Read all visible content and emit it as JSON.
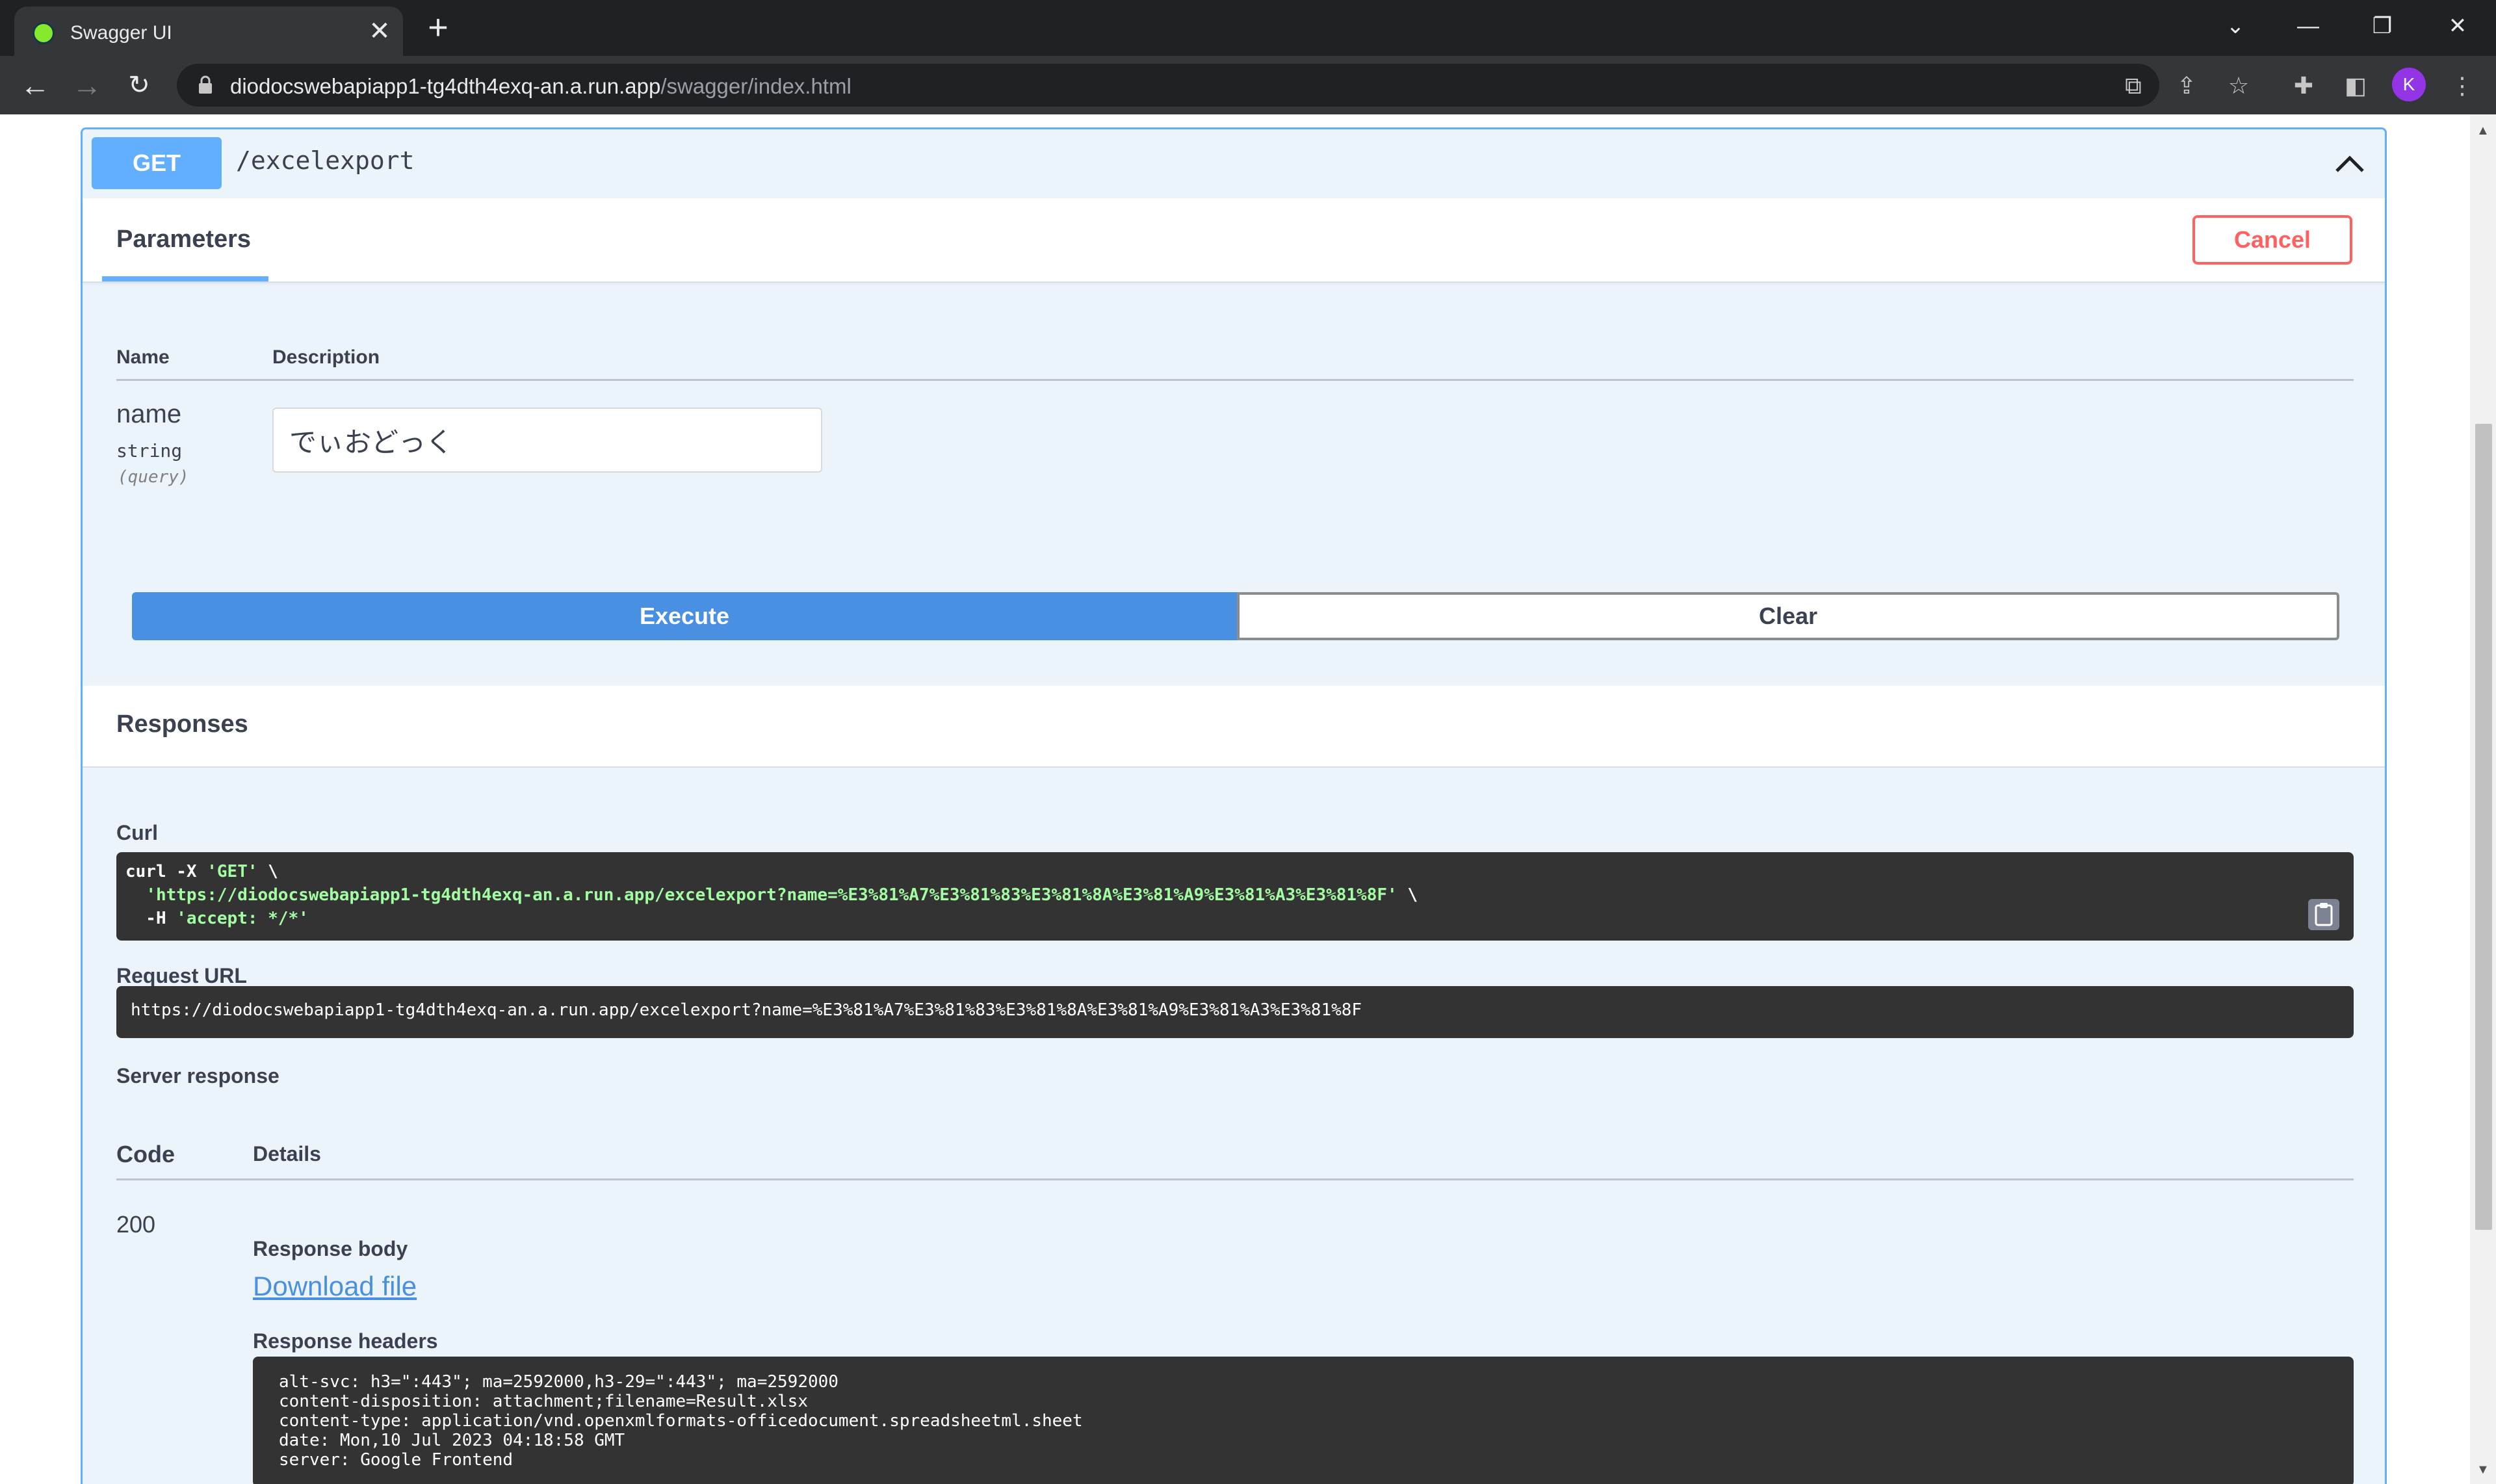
{
  "browser": {
    "tab_title": "Swagger UI",
    "tab_close": "✕",
    "new_tab": "+",
    "url_host": "diodocswebapiapp1-tg4dth4exq-an.a.run.app",
    "url_path": "/swagger/index.html",
    "avatar_initial": "K",
    "window_controls": {
      "tab_search": "⌄",
      "minimize": "—",
      "restore": "❐",
      "close": "✕"
    }
  },
  "operation": {
    "method": "GET",
    "path": "/excelexport",
    "parameters_title": "Parameters",
    "cancel_label": "Cancel",
    "table_headers": {
      "name": "Name",
      "description": "Description"
    },
    "parameter": {
      "name": "name",
      "type": "string",
      "location": "(query)",
      "value": "でぃおどっく"
    },
    "execute_label": "Execute",
    "clear_label": "Clear"
  },
  "responses": {
    "title": "Responses",
    "curl_label": "Curl",
    "curl_lines": {
      "line1_cmd": "curl -X ",
      "line1_str": "'GET'",
      "line1_tail": " \\",
      "line2_str": "'https://diodocswebapiapp1-tg4dth4exq-an.a.run.app/excelexport?name=%E3%81%A7%E3%81%83%E3%81%8A%E3%81%A9%E3%81%A3%E3%81%8F'",
      "line2_tail": " \\",
      "line3_cmd": "  -H ",
      "line3_str": "'accept: */*'"
    },
    "request_url_label": "Request URL",
    "request_url": "https://diodocswebapiapp1-tg4dth4exq-an.a.run.app/excelexport?name=%E3%81%A7%E3%81%83%E3%81%8A%E3%81%A9%E3%81%A3%E3%81%8F",
    "server_response_label": "Server response",
    "code_header": "Code",
    "details_header": "Details",
    "code": "200",
    "response_body_label": "Response body",
    "download_label": "Download file",
    "response_headers_label": "Response headers",
    "response_headers": "alt-svc: h3=\":443\"; ma=2592000,h3-29=\":443\"; ma=2592000\ncontent-disposition: attachment;filename=Result.xlsx\ncontent-type: application/vnd.openxmlformats-officedocument.spreadsheetml.sheet\ndate: Mon,10 Jul 2023 04:18:58 GMT\nserver: Google Frontend"
  },
  "colors": {
    "get_blue": "#61affe",
    "execute_blue": "#4990e2",
    "cancel_red": "#ff6060",
    "code_bg": "#333333",
    "curl_string_green": "#a2fca2"
  }
}
